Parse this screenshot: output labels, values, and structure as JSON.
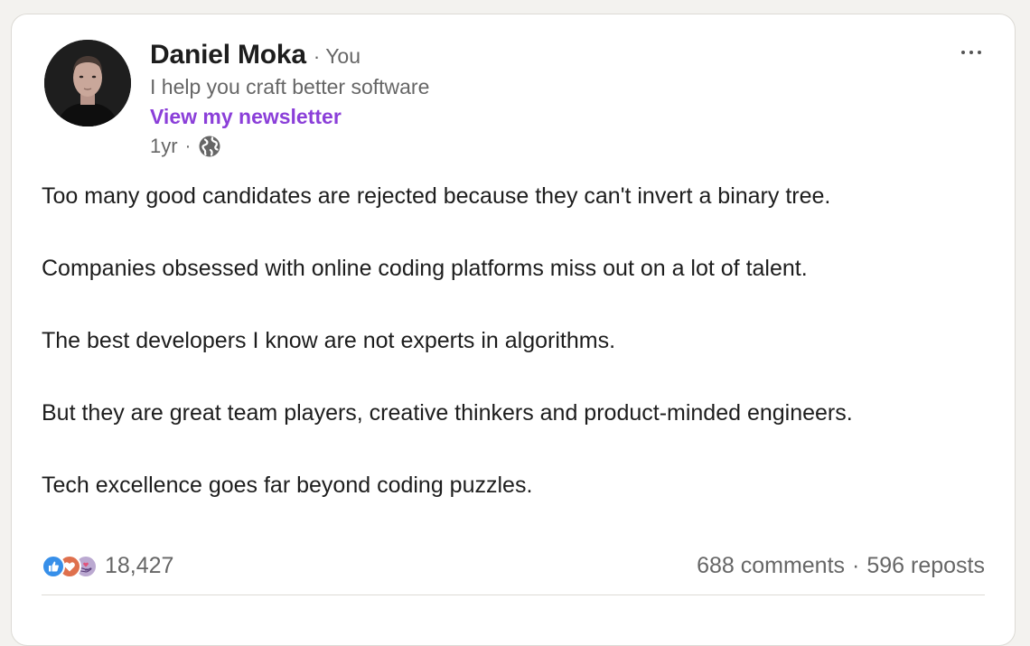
{
  "post": {
    "author": {
      "name": "Daniel Moka",
      "relation": "You",
      "headline": "I help you craft better software",
      "newsletter_link": "View my newsletter",
      "time": "1yr",
      "visibility_icon": "globe-icon"
    },
    "menu_icon": "more-horizontal-icon",
    "body": [
      "Too many good candidates are rejected because they can't invert a binary tree.",
      "Companies obsessed with online coding platforms miss out on a lot of talent.",
      "The best developers I know are not experts in algorithms.",
      "But they are great team players, creative thinkers and product-minded engineers.",
      "Tech excellence goes far beyond coding puzzles."
    ],
    "reactions": {
      "icons": [
        "like-icon",
        "love-icon",
        "support-icon"
      ],
      "count": "18,427"
    },
    "comments": "688 comments",
    "reposts": "596 reposts",
    "separator": "·"
  },
  "colors": {
    "newsletter": "#8b3fd9",
    "text_primary": "#1d1d1d",
    "text_secondary": "#666666",
    "like": "#378fe9",
    "love": "#df704d",
    "support": "#bba9d1"
  }
}
